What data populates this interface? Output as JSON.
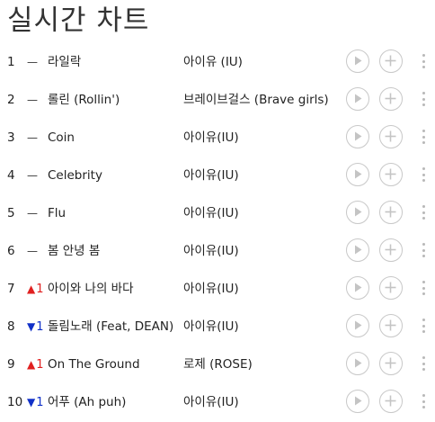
{
  "page": {
    "title": "실시간 차트"
  },
  "colors": {
    "up": "#e02020",
    "down": "#1030c8",
    "icon_stroke": "#c8c8c8"
  },
  "chart": {
    "rows": [
      {
        "rank": "1",
        "change_type": "same",
        "change_symbol": "—",
        "change_value": "",
        "song": "라일락",
        "artist": "아이유 (IU)"
      },
      {
        "rank": "2",
        "change_type": "same",
        "change_symbol": "—",
        "change_value": "",
        "song": "롤린 (Rollin')",
        "artist": "브레이브걸스 (Brave girls)"
      },
      {
        "rank": "3",
        "change_type": "same",
        "change_symbol": "—",
        "change_value": "",
        "song": "Coin",
        "artist": "아이유(IU)"
      },
      {
        "rank": "4",
        "change_type": "same",
        "change_symbol": "—",
        "change_value": "",
        "song": "Celebrity",
        "artist": "아이유(IU)"
      },
      {
        "rank": "5",
        "change_type": "same",
        "change_symbol": "—",
        "change_value": "",
        "song": "Flu",
        "artist": "아이유(IU)"
      },
      {
        "rank": "6",
        "change_type": "same",
        "change_symbol": "—",
        "change_value": "",
        "song": "봄 안녕 봄",
        "artist": "아이유(IU)"
      },
      {
        "rank": "7",
        "change_type": "up",
        "change_symbol": "▲",
        "change_value": "1",
        "song": "아이와 나의 바다",
        "artist": "아이유(IU)"
      },
      {
        "rank": "8",
        "change_type": "down",
        "change_symbol": "▼",
        "change_value": "1",
        "song": "돌림노래 (Feat, DEAN)",
        "artist": "아이유(IU)"
      },
      {
        "rank": "9",
        "change_type": "up",
        "change_symbol": "▲",
        "change_value": "1",
        "song": "On The Ground",
        "artist": "로제 (ROSE)"
      },
      {
        "rank": "10",
        "change_type": "down",
        "change_symbol": "▼",
        "change_value": "1",
        "song": "어푸 (Ah puh)",
        "artist": "아이유(IU)"
      }
    ]
  },
  "icons": {
    "play": "play-icon",
    "add": "plus-icon",
    "more": "more-vertical-icon"
  }
}
